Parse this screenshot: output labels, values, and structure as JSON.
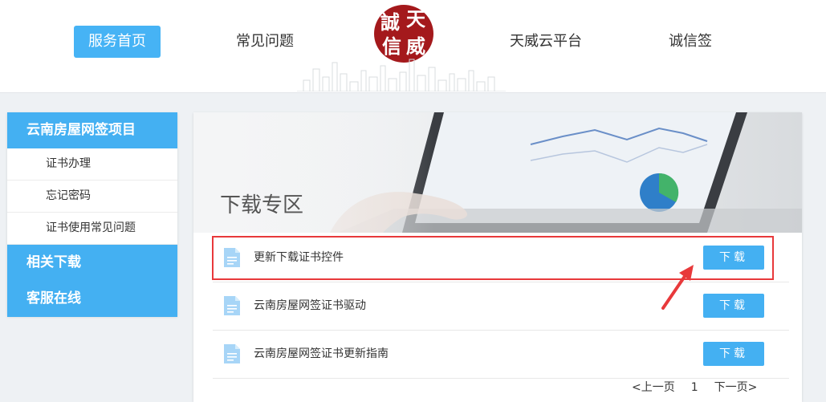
{
  "nav": {
    "items": [
      "服务首页",
      "常见问题",
      "天威云平台",
      "诚信签"
    ],
    "active_index": 0
  },
  "logo": {
    "chars": [
      "誠",
      "天",
      "信",
      "威"
    ]
  },
  "sidebar": {
    "project_title": "云南房屋网签项目",
    "sub_items": [
      "证书办理",
      "忘记密码",
      "证书使用常见问题"
    ],
    "related_download": "相关下载",
    "customer_service": "客服在线"
  },
  "banner": {
    "title": "下载专区"
  },
  "downloads": [
    {
      "name": "更新下载证书控件",
      "button": "下载"
    },
    {
      "name": "云南房屋网签证书驱动",
      "button": "下载"
    },
    {
      "name": "云南房屋网签证书更新指南",
      "button": "下载"
    }
  ],
  "pager": {
    "prev": "<上一页",
    "current": "1",
    "next": "下一页>"
  },
  "colors": {
    "accent": "#44b0f2",
    "logo_red": "#a4191c",
    "highlight_red": "#e8393b"
  }
}
